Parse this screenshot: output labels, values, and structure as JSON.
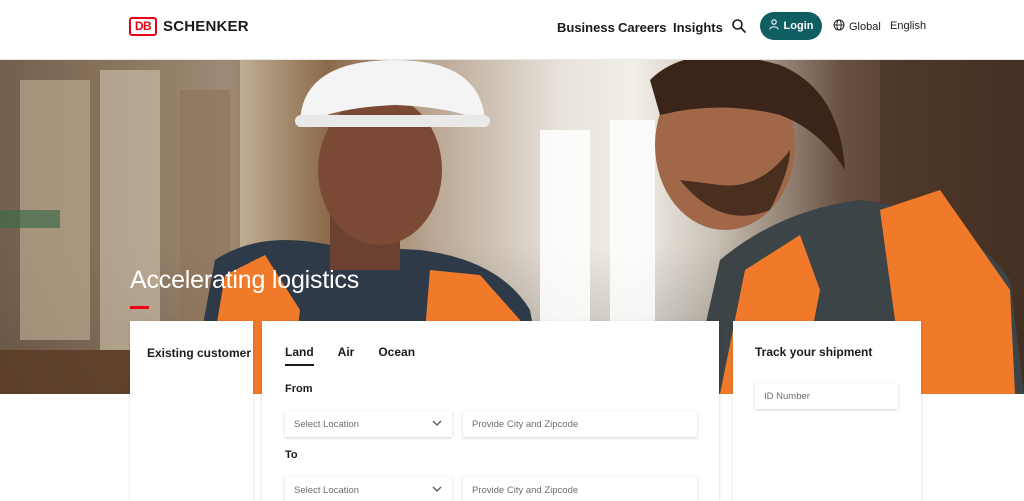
{
  "header": {
    "logo_mark": "DB",
    "brand": "SCHENKER",
    "nav": [
      "Business",
      "Careers",
      "Insights"
    ],
    "login_label": "Login",
    "region_label": "Global",
    "language_label": "English",
    "icons": {
      "search": "search-icon",
      "user": "user-icon",
      "globe": "globe-icon"
    },
    "accent_color": "#0f5e61",
    "brand_color": "#ec0016"
  },
  "hero": {
    "title": "Accelerating logistics"
  },
  "existing": {
    "title": "Existing customer"
  },
  "quote": {
    "tabs": [
      "Land",
      "Air",
      "Ocean"
    ],
    "active_tab": "Land",
    "from_label": "From",
    "to_label": "To",
    "location_placeholder": "Select Location",
    "zip_placeholder": "Provide City and Zipcode"
  },
  "track": {
    "title": "Track your shipment",
    "id_placeholder": "ID Number"
  }
}
